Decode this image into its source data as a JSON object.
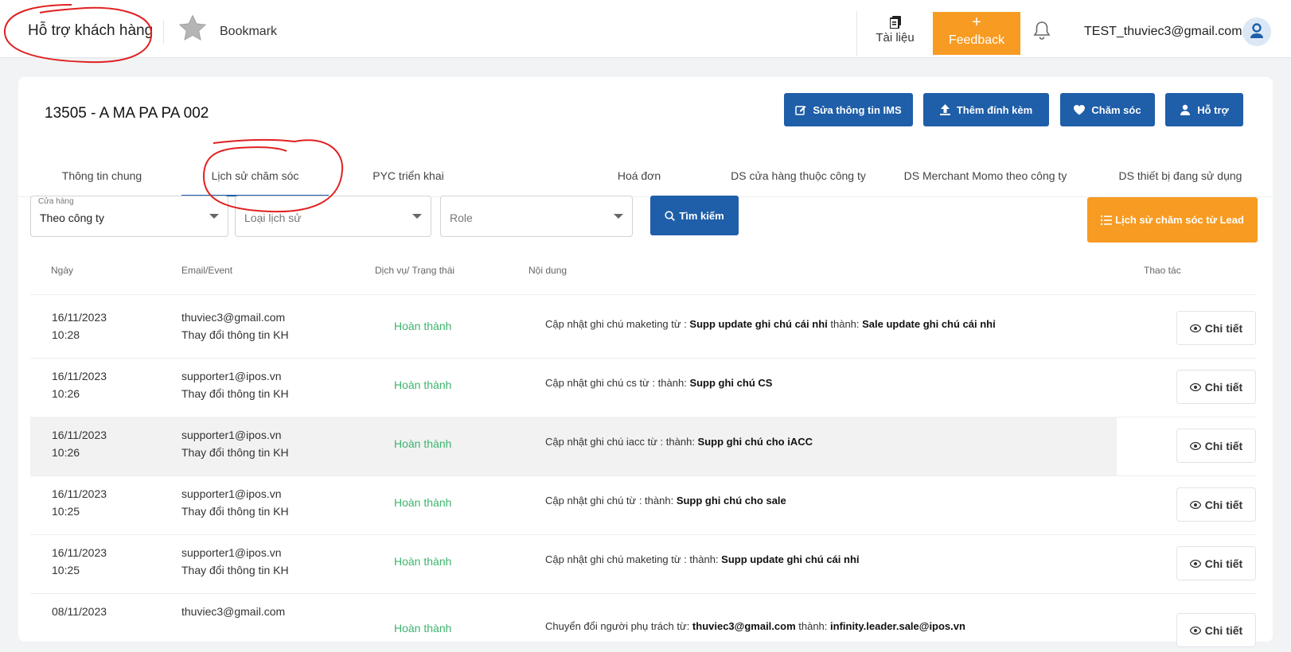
{
  "header": {
    "app_title": "Hỗ trợ khách hàng",
    "bookmark_label": "Bookmark",
    "docs_label": "Tài liệu",
    "feedback_label": "Feedback",
    "user_email": "TEST_thuviec3@gmail.com"
  },
  "company": {
    "title": "13505 - A MA PA PA 002"
  },
  "actions": {
    "edit_ims": "Sửa thông tin IMS",
    "add_attachment": "Thêm đính kèm",
    "care": "Chăm sóc",
    "support": "Hỗ trợ"
  },
  "tabs": [
    {
      "label": "Thông tin chung"
    },
    {
      "label": "Lịch sử chăm sóc"
    },
    {
      "label": "PYC triển khai"
    },
    {
      "label": "Hoá đơn"
    },
    {
      "label": "DS cửa hàng thuộc công ty"
    },
    {
      "label": "DS Merchant Momo theo công ty"
    },
    {
      "label": "DS thiết bị đang sử dụng"
    }
  ],
  "filters": {
    "store_label": "Cửa hàng",
    "store_value": "Theo công ty",
    "history_type_placeholder": "Loại lịch sử",
    "role_placeholder": "Role",
    "search_label": "Tìm kiếm",
    "lead_history_label": "Lịch sử chăm sóc từ Lead"
  },
  "table": {
    "columns": {
      "date": "Ngày",
      "email_event": "Email/Event",
      "service_status": "Dịch vụ/ Trạng thái",
      "content": "Nội dung",
      "actions": "Thao tác"
    },
    "detail_label": "Chi tiết",
    "rows": [
      {
        "date": "16/11/2023",
        "time": "10:28",
        "email": "thuviec3@gmail.com",
        "event": "Thay đổi thông tin KH",
        "status": "Hoàn thành",
        "c1": "Cập nhật ghi chú maketing từ : ",
        "c2": "Supp update ghi chú cái nhỉ",
        "c3": " thành: ",
        "c4": "Sale update ghi chú cái nhỉ"
      },
      {
        "date": "16/11/2023",
        "time": "10:26",
        "email": "supporter1@ipos.vn",
        "event": "Thay đổi thông tin KH",
        "status": "Hoàn thành",
        "c1": "Cập nhật ghi chú cs từ : thành: ",
        "c2": "Supp ghi chú CS",
        "c3": "",
        "c4": ""
      },
      {
        "date": "16/11/2023",
        "time": "10:26",
        "email": "supporter1@ipos.vn",
        "event": "Thay đổi thông tin KH",
        "status": "Hoàn thành",
        "c1": "Cập nhật ghi chú iacc từ : thành: ",
        "c2": "Supp ghi chú cho iACC",
        "c3": "",
        "c4": ""
      },
      {
        "date": "16/11/2023",
        "time": "10:25",
        "email": "supporter1@ipos.vn",
        "event": "Thay đổi thông tin KH",
        "status": "Hoàn thành",
        "c1": "Cập nhật ghi chú từ : thành: ",
        "c2": "Supp ghi chú cho sale",
        "c3": "",
        "c4": ""
      },
      {
        "date": "16/11/2023",
        "time": "10:25",
        "email": "supporter1@ipos.vn",
        "event": "Thay đổi thông tin KH",
        "status": "Hoàn thành",
        "c1": "Cập nhật ghi chú maketing từ : thành: ",
        "c2": "Supp update ghi chú cái nhỉ",
        "c3": "",
        "c4": ""
      },
      {
        "date": "08/11/2023",
        "time": "",
        "email": "thuviec3@gmail.com",
        "event": "",
        "status": "Hoàn thành",
        "c1": "Chuyển đổi người phụ trách từ: ",
        "c2": "thuviec3@gmail.com",
        "c3": " thành: ",
        "c4": "infinity.leader.sale@ipos.vn"
      }
    ]
  },
  "colors": {
    "primary": "#1f5ea8",
    "accent": "#f79b22",
    "success": "#3db46d",
    "annotation": "#e02020"
  }
}
